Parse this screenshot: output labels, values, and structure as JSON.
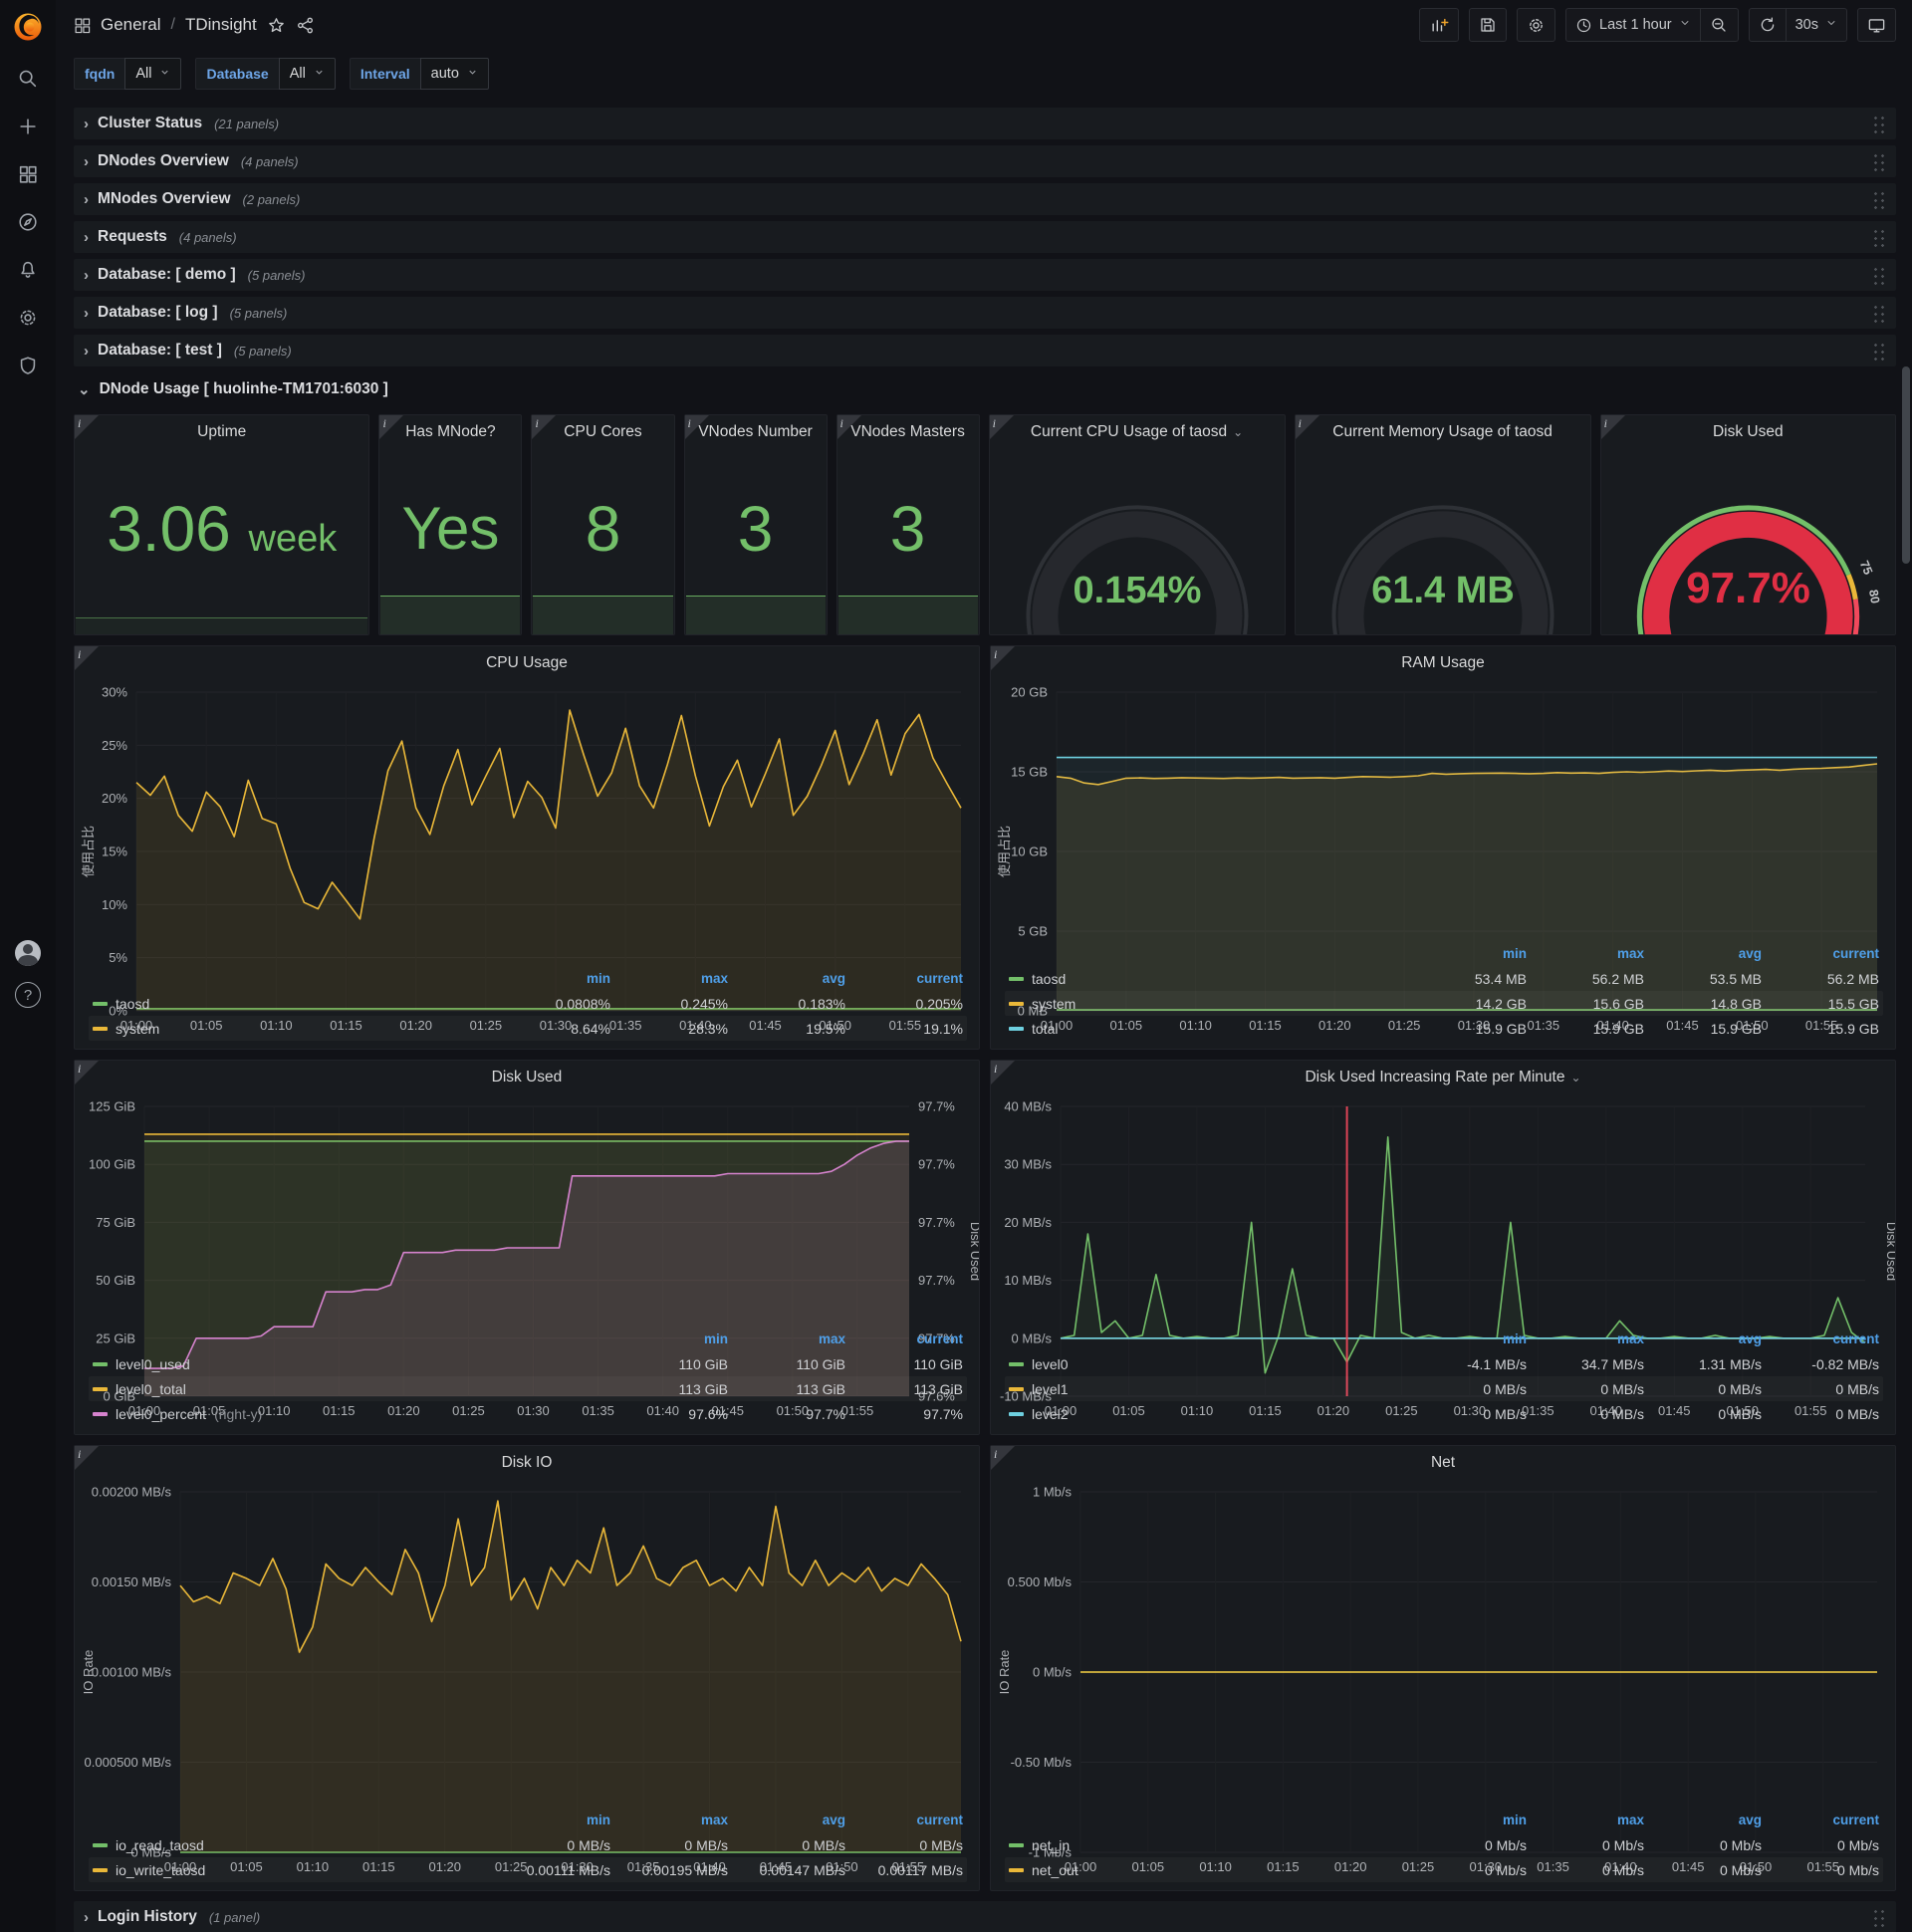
{
  "nav": {
    "breadcrumb_root": "General",
    "breadcrumb_sep": "/",
    "breadcrumb_page": "TDinsight",
    "time_range": "Last 1 hour",
    "refresh_interval": "30s"
  },
  "submenu": {
    "vars": [
      {
        "label": "fqdn",
        "value": "All"
      },
      {
        "label": "Database",
        "value": "All"
      },
      {
        "label": "Interval",
        "value": "auto"
      }
    ]
  },
  "rows": [
    {
      "label": "Cluster Status",
      "count": "(21 panels)"
    },
    {
      "label": "DNodes Overview",
      "count": "(4 panels)"
    },
    {
      "label": "MNodes Overview",
      "count": "(2 panels)"
    },
    {
      "label": "Requests",
      "count": "(4 panels)"
    },
    {
      "label": "Database: [ demo ]",
      "count": "(5 panels)"
    },
    {
      "label": "Database: [ log ]",
      "count": "(5 panels)"
    },
    {
      "label": "Database: [ test ]",
      "count": "(5 panels)"
    }
  ],
  "dnode_row": {
    "label": "DNode Usage [ huolinhe-TM1701:6030 ]"
  },
  "login_row": {
    "label": "Login History",
    "count": "(1 panel)"
  },
  "stats": {
    "uptime": {
      "title": "Uptime",
      "value": "3.06",
      "unit": "week"
    },
    "has_mnode": {
      "title": "Has MNode?",
      "value": "Yes"
    },
    "cpu_cores": {
      "title": "CPU Cores",
      "value": "8"
    },
    "vnodes_number": {
      "title": "VNodes Number",
      "value": "3"
    },
    "vnodes_masters": {
      "title": "VNodes Masters",
      "value": "3"
    }
  },
  "gauges": {
    "cpu": {
      "title": "Current CPU Usage of taosd",
      "value": "0.154%",
      "min": "0",
      "max": "100",
      "frac": 0.0015,
      "color": "#73BF69",
      "font": 38
    },
    "mem": {
      "title": "Current Memory Usage of taosd",
      "value": "61.4 MB",
      "min": "0",
      "max": "1589",
      "frac": 0.039,
      "color": "#73BF69",
      "font": 38
    },
    "disk": {
      "title": "Disk Used",
      "value": "97.7%",
      "min": "0",
      "frac": 0.977,
      "color": "#E02F44",
      "font": 44,
      "ring": [
        {
          "f0": 0,
          "f1": 0.75,
          "c": "#73BF69"
        },
        {
          "f0": 0.75,
          "f1": 0.8,
          "c": "#EAB839"
        },
        {
          "f0": 0.8,
          "f1": 1.0,
          "c": "#F2495C"
        }
      ],
      "thresholds": [
        {
          "t": "75",
          "f": 0.75
        },
        {
          "t": "80",
          "f": 0.8
        },
        {
          "t": "95",
          "f": 0.95
        },
        {
          "t": "100",
          "f": 1.0
        }
      ]
    }
  },
  "colors": {
    "green": "#73BF69",
    "yellow": "#EAB839",
    "cyan": "#6ED0E0",
    "magenta": "#D683CE",
    "red": "#F2495C"
  },
  "chart_data": [
    {
      "type": "area",
      "title": "CPU Usage",
      "ylabel": "使用占比",
      "ylim": [
        0,
        30
      ],
      "n": 60,
      "margin_left": 62,
      "yticks": [
        {
          "v": 30,
          "t": "30%"
        },
        {
          "v": 25,
          "t": "25%"
        },
        {
          "v": 20,
          "t": "20%"
        },
        {
          "v": 15,
          "t": "15%"
        },
        {
          "v": 10,
          "t": "10%"
        },
        {
          "v": 5,
          "t": "5%"
        },
        {
          "v": 0,
          "t": "0%"
        }
      ],
      "xticks": [
        "01:00",
        "01:05",
        "01:10",
        "01:15",
        "01:20",
        "01:25",
        "01:30",
        "01:35",
        "01:40",
        "01:45",
        "01:50",
        "01:55"
      ],
      "series": [
        {
          "name": "taosd",
          "color": "green",
          "flat": 0.2,
          "fill": 0.1
        },
        {
          "name": "system",
          "color": "yellow",
          "fill": 0.1,
          "values": [
            21.5,
            20.3,
            22.1,
            18.4,
            16.9,
            20.6,
            19.2,
            16.4,
            21.7,
            18.1,
            17.6,
            13.4,
            10.2,
            9.6,
            12.1,
            10.4,
            8.64,
            16.2,
            22.6,
            25.4,
            19.1,
            16.6,
            21.2,
            24.6,
            19.4,
            22.1,
            24.7,
            18.2,
            21.6,
            20.1,
            17.2,
            28.3,
            24.1,
            20.2,
            22.4,
            26.6,
            21.2,
            19.1,
            23.2,
            27.8,
            22.1,
            17.4,
            21.1,
            23.6,
            19.2,
            22.3,
            25.6,
            18.4,
            20.2,
            23.1,
            26.4,
            21.3,
            24.2,
            27.4,
            22.2,
            26.1,
            27.9,
            23.8,
            21.4,
            19.1
          ]
        }
      ],
      "legend": {
        "cols": [
          "min",
          "max",
          "avg",
          "current"
        ],
        "rows": [
          {
            "name": "taosd",
            "color": "green",
            "values": [
              "0.0808%",
              "0.245%",
              "0.183%",
              "0.205%"
            ]
          },
          {
            "name": "system",
            "color": "yellow",
            "values": [
              "8.64%",
              "28.3%",
              "19.5%",
              "19.1%"
            ]
          }
        ]
      }
    },
    {
      "type": "area",
      "title": "RAM Usage",
      "ylabel": "使用占比",
      "ylim": [
        0,
        20
      ],
      "n": 60,
      "margin_left": 66,
      "yticks": [
        {
          "v": 20,
          "t": "20 GB"
        },
        {
          "v": 15,
          "t": "15 GB"
        },
        {
          "v": 10,
          "t": "10 GB"
        },
        {
          "v": 5,
          "t": "5 GB"
        },
        {
          "v": 0,
          "t": "0 MB"
        }
      ],
      "xticks": [
        "01:00",
        "01:05",
        "01:10",
        "01:15",
        "01:20",
        "01:25",
        "01:30",
        "01:35",
        "01:40",
        "01:45",
        "01:50",
        "01:55"
      ],
      "series": [
        {
          "name": "taosd",
          "color": "green",
          "flat": 0.055,
          "fill": 0.08
        },
        {
          "name": "system",
          "color": "yellow",
          "fill": 0.1,
          "values": [
            14.7,
            14.6,
            14.3,
            14.2,
            14.4,
            14.6,
            14.62,
            14.58,
            14.6,
            14.63,
            14.61,
            14.6,
            14.58,
            14.61,
            14.6,
            14.62,
            14.65,
            14.6,
            14.61,
            14.63,
            14.6,
            14.65,
            14.7,
            14.68,
            14.66,
            14.7,
            14.75,
            14.9,
            14.85,
            14.88,
            14.9,
            14.91,
            14.92,
            14.9,
            14.88,
            14.9,
            14.95,
            14.92,
            14.93,
            14.9,
            14.96,
            15.0,
            14.97,
            15.0,
            15.05,
            15.02,
            15.06,
            15.1,
            15.05,
            15.1,
            15.12,
            15.15,
            15.1,
            15.16,
            15.2,
            15.22,
            15.26,
            15.3,
            15.4,
            15.5
          ]
        },
        {
          "name": "total",
          "color": "cyan",
          "flat": 15.9,
          "fill": 0.06
        }
      ],
      "legend": {
        "cols": [
          "min",
          "max",
          "avg",
          "current"
        ],
        "rows": [
          {
            "name": "taosd",
            "color": "green",
            "values": [
              "53.4 MB",
              "56.2 MB",
              "53.5 MB",
              "56.2 MB"
            ]
          },
          {
            "name": "system",
            "color": "yellow",
            "values": [
              "14.2 GB",
              "15.6 GB",
              "14.8 GB",
              "15.5 GB"
            ]
          },
          {
            "name": "total",
            "color": "cyan",
            "values": [
              "15.9 GB",
              "15.9 GB",
              "15.9 GB",
              "15.9 GB"
            ]
          }
        ]
      }
    },
    {
      "type": "area",
      "title": "Disk Used",
      "ylim": [
        0,
        125
      ],
      "n": 60,
      "margin_left": 70,
      "margin_right": 70,
      "right_label": "Disk Used",
      "right_ticks": [
        "97.7%",
        "97.7%",
        "97.7%",
        "97.7%",
        "97.7%",
        "97.6%"
      ],
      "yticks": [
        {
          "v": 125,
          "t": "125 GiB"
        },
        {
          "v": 100,
          "t": "100 GiB"
        },
        {
          "v": 75,
          "t": "75 GiB"
        },
        {
          "v": 50,
          "t": "50 GiB"
        },
        {
          "v": 25,
          "t": "25 GiB"
        },
        {
          "v": 0,
          "t": "0 GiB"
        }
      ],
      "xticks": [
        "01:00",
        "01:05",
        "01:10",
        "01:15",
        "01:20",
        "01:25",
        "01:30",
        "01:35",
        "01:40",
        "01:45",
        "01:50",
        "01:55"
      ],
      "series": [
        {
          "name": "level0_used",
          "color": "green",
          "flat": 110,
          "fill": 0.09
        },
        {
          "name": "level0_total",
          "color": "yellow",
          "flat": 113,
          "fill": 0.07
        },
        {
          "name": "level0_percent",
          "color": "magenta",
          "fill": 0.13,
          "values": [
            12,
            12,
            12,
            13,
            25,
            25,
            25,
            25,
            25,
            26,
            30,
            30,
            30,
            30,
            45,
            45,
            45,
            46,
            46,
            48,
            62,
            62,
            62,
            62,
            63,
            63,
            63,
            63,
            64,
            64,
            64,
            64,
            64,
            95,
            95,
            95,
            95,
            95,
            95,
            95,
            95,
            95,
            95,
            95,
            95,
            96,
            96,
            96,
            96,
            96,
            96,
            96,
            96,
            97,
            100,
            104,
            107,
            109,
            110,
            110
          ]
        }
      ],
      "legend": {
        "cols": [
          "min",
          "max",
          "current"
        ],
        "rows": [
          {
            "name": "level0_used",
            "color": "green",
            "values": [
              "110 GiB",
              "110 GiB",
              "110 GiB"
            ]
          },
          {
            "name": "level0_total",
            "color": "yellow",
            "values": [
              "113 GiB",
              "113 GiB",
              "113 GiB"
            ]
          },
          {
            "name": "level0_percent",
            "note": "(right-y)",
            "color": "magenta",
            "values": [
              "97.6%",
              "97.7%",
              "97.7%"
            ]
          }
        ]
      }
    },
    {
      "type": "line",
      "title": "Disk Used Increasing Rate per Minute",
      "title_caret": true,
      "ylim": [
        -10,
        40
      ],
      "n": 60,
      "margin_left": 70,
      "margin_right": 30,
      "right_label": "Disk Used",
      "annotation": 21,
      "yticks": [
        {
          "v": 40,
          "t": "40 MB/s"
        },
        {
          "v": 30,
          "t": "30 MB/s"
        },
        {
          "v": 20,
          "t": "20 MB/s"
        },
        {
          "v": 10,
          "t": "10 MB/s"
        },
        {
          "v": 0,
          "t": "0 MB/s"
        },
        {
          "v": -10,
          "t": "-10 MB/s"
        }
      ],
      "xticks": [
        "01:00",
        "01:05",
        "01:10",
        "01:15",
        "01:20",
        "01:25",
        "01:30",
        "01:35",
        "01:40",
        "01:45",
        "01:50",
        "01:55"
      ],
      "series": [
        {
          "name": "level0",
          "color": "green",
          "fill": 0.08,
          "values": [
            0,
            0.5,
            18,
            1,
            3,
            0,
            0.5,
            11,
            0.5,
            0,
            0.3,
            0,
            0,
            0.5,
            20,
            -6,
            0.5,
            12,
            0.5,
            0,
            0,
            -4.1,
            0.5,
            0,
            34.7,
            1,
            0,
            0.5,
            0,
            0,
            0.3,
            0,
            0,
            20,
            0.5,
            0,
            0,
            0.3,
            0,
            0,
            0,
            3,
            0.5,
            0,
            0,
            0.3,
            0,
            0,
            0.5,
            0,
            0,
            0,
            0.3,
            0,
            0,
            0,
            0.5,
            7,
            1,
            -0.8
          ]
        },
        {
          "name": "level1",
          "color": "yellow",
          "flat": 0,
          "fill": 0
        },
        {
          "name": "level2",
          "color": "cyan",
          "flat": 0,
          "fill": 0
        }
      ],
      "legend": {
        "cols": [
          "min",
          "max",
          "avg",
          "current"
        ],
        "rows": [
          {
            "name": "level0",
            "color": "green",
            "values": [
              "-4.1 MB/s",
              "34.7 MB/s",
              "1.31 MB/s",
              "-0.82 MB/s"
            ]
          },
          {
            "name": "level1",
            "color": "yellow",
            "values": [
              "0 MB/s",
              "0 MB/s",
              "0 MB/s",
              "0 MB/s"
            ]
          },
          {
            "name": "level2",
            "color": "cyan",
            "values": [
              "0 MB/s",
              "0 MB/s",
              "0 MB/s",
              "0 MB/s"
            ]
          }
        ]
      }
    },
    {
      "type": "area",
      "title": "Disk IO",
      "ylabel": "IO Rate",
      "ylim": [
        0,
        0.002
      ],
      "n": 60,
      "margin_left": 106,
      "yticks": [
        {
          "v": 0.002,
          "t": "0.00200 MB/s"
        },
        {
          "v": 0.0015,
          "t": "0.00150 MB/s"
        },
        {
          "v": 0.001,
          "t": "0.00100 MB/s"
        },
        {
          "v": 0.0005,
          "t": "0.000500 MB/s"
        },
        {
          "v": 0,
          "t": "0 MB/s"
        }
      ],
      "xticks": [
        "01:00",
        "01:05",
        "01:10",
        "01:15",
        "01:20",
        "01:25",
        "01:30",
        "01:35",
        "01:40",
        "01:45",
        "01:50",
        "01:55"
      ],
      "series": [
        {
          "name": "io_read_taosd",
          "color": "green",
          "flat": 0,
          "fill": 0.08
        },
        {
          "name": "io_write_taosd",
          "color": "yellow",
          "fill": 0.12,
          "values": [
            0.00148,
            0.00139,
            0.00142,
            0.00138,
            0.00155,
            0.00152,
            0.00148,
            0.00163,
            0.00146,
            0.00111,
            0.00125,
            0.0016,
            0.00152,
            0.00148,
            0.00158,
            0.0015,
            0.00143,
            0.00168,
            0.00155,
            0.00128,
            0.00148,
            0.00185,
            0.00148,
            0.00158,
            0.00195,
            0.0014,
            0.00152,
            0.00135,
            0.00158,
            0.00148,
            0.00162,
            0.00155,
            0.0018,
            0.00148,
            0.00155,
            0.0017,
            0.00152,
            0.00148,
            0.00158,
            0.00162,
            0.00148,
            0.00152,
            0.00145,
            0.00158,
            0.00148,
            0.00192,
            0.00155,
            0.00148,
            0.00162,
            0.00148,
            0.00155,
            0.0015,
            0.00158,
            0.00145,
            0.00152,
            0.00148,
            0.0016,
            0.00152,
            0.00143,
            0.00117
          ]
        }
      ],
      "legend": {
        "cols": [
          "min",
          "max",
          "avg",
          "current"
        ],
        "rows": [
          {
            "name": "io_read_taosd",
            "color": "green",
            "values": [
              "0 MB/s",
              "0 MB/s",
              "0 MB/s",
              "0 MB/s"
            ]
          },
          {
            "name": "io_write_taosd",
            "color": "yellow",
            "values": [
              "0.00111 MB/s",
              "0.00195 MB/s",
              "0.00147 MB/s",
              "0.00117 MB/s"
            ]
          }
        ]
      }
    },
    {
      "type": "line",
      "title": "Net",
      "ylabel": "IO Rate",
      "ylim": [
        -1,
        1
      ],
      "n": 60,
      "margin_left": 90,
      "yticks": [
        {
          "v": 1,
          "t": "1 Mb/s"
        },
        {
          "v": 0.5,
          "t": "0.500 Mb/s"
        },
        {
          "v": 0,
          "t": "0 Mb/s"
        },
        {
          "v": -0.5,
          "t": "-0.50 Mb/s"
        },
        {
          "v": -1,
          "t": "-1 Mb/s"
        }
      ],
      "xticks": [
        "01:00",
        "01:05",
        "01:10",
        "01:15",
        "01:20",
        "01:25",
        "01:30",
        "01:35",
        "01:40",
        "01:45",
        "01:50",
        "01:55"
      ],
      "series": [
        {
          "name": "net_in",
          "color": "green",
          "flat": 0,
          "fill": 0
        },
        {
          "name": "net_out",
          "color": "yellow",
          "flat": 0,
          "fill": 0
        }
      ],
      "legend": {
        "cols": [
          "min",
          "max",
          "avg",
          "current"
        ],
        "rows": [
          {
            "name": "net_in",
            "color": "green",
            "values": [
              "0 Mb/s",
              "0 Mb/s",
              "0 Mb/s",
              "0 Mb/s"
            ]
          },
          {
            "name": "net_out",
            "color": "yellow",
            "values": [
              "0 Mb/s",
              "0 Mb/s",
              "0 Mb/s",
              "0 Mb/s"
            ]
          }
        ]
      }
    }
  ]
}
